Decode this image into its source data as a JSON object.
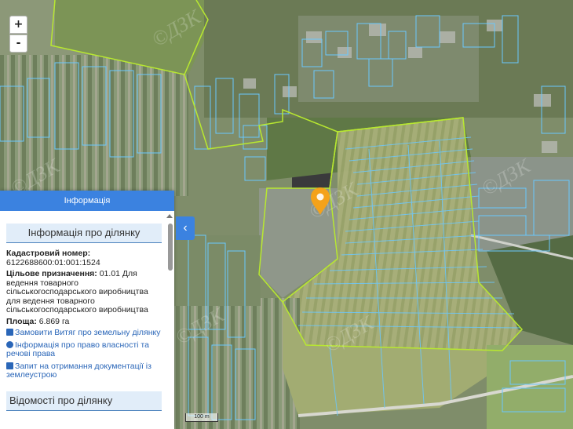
{
  "map": {
    "marker_color": "#f4a21a",
    "highlight_color": "#c8f050",
    "parcel_line_color": "#6ac8ff",
    "boundary_color": "#b8e830",
    "watermark_text": "©ДЗК",
    "scale_label": "100 m"
  },
  "zoom": {
    "in_label": "+",
    "out_label": "-"
  },
  "panel": {
    "header": "Інформація",
    "section_title": "Інформація про ділянку",
    "cadastral_label": "Кадастровий номер:",
    "cadastral_value": "6122688600:01:001:1524",
    "purpose_label": "Цільове призначення:",
    "purpose_value": "01.01 Для ведення товарного сільськогосподарського виробництва для ведення товарного сільськогосподарського виробництва",
    "area_label": "Площа:",
    "area_value": "6.869 га",
    "links": [
      {
        "icon": "document-icon",
        "label": "Замовити Витяг про земельну ділянку"
      },
      {
        "icon": "info-circle-icon",
        "label": "Інформація про право власності та речові права"
      },
      {
        "icon": "document-icon",
        "label": "Запит на отримання документації із землеустрою"
      }
    ],
    "next_section_title": "Відомості про ділянку"
  }
}
